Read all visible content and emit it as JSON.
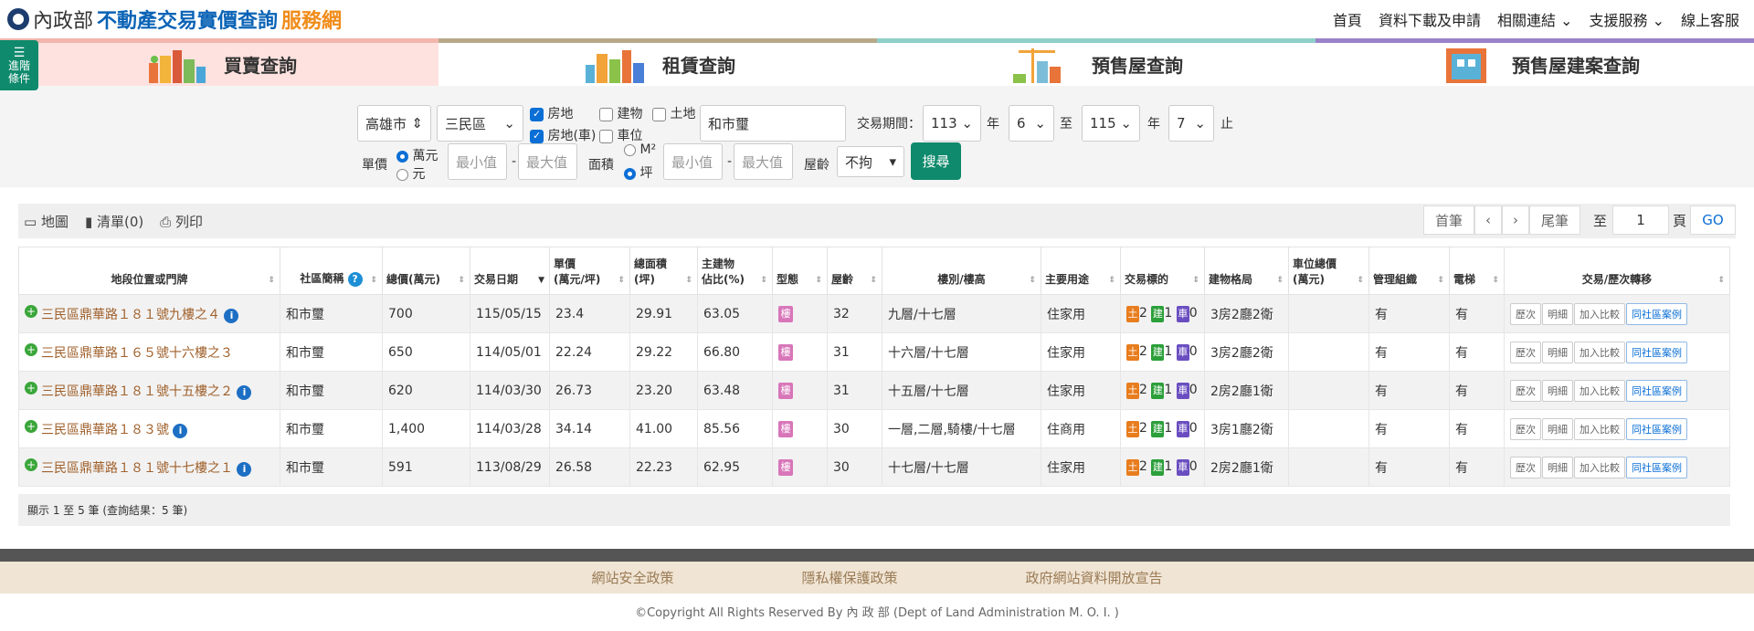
{
  "header": {
    "logo_ministry": "內政部",
    "logo_main": "不動產交易實價查詢",
    "logo_sub": "服務網",
    "nav": [
      "首頁",
      "資料下載及申請",
      "相關連結",
      "支援服務",
      "線上客服"
    ]
  },
  "adv_button": {
    "line1": "進階",
    "line2": "條件"
  },
  "tabs": [
    "買賣查詢",
    "租賃查詢",
    "預售屋查詢",
    "預售屋建案查詢"
  ],
  "filter": {
    "city": "高雄市",
    "district": "三民區",
    "types": {
      "house": "房地",
      "building": "建物",
      "land": "土地",
      "house_car": "房地(車)",
      "parking": "車位"
    },
    "community_value": "和市璽",
    "period_label": "交易期間：",
    "from_year": "113",
    "from_month": "6",
    "to_year": "115",
    "to_month": "7",
    "year_unit": "年",
    "to_label": "至",
    "end_label": "止",
    "unit_price_label": "單價",
    "unit_wan": "萬元",
    "unit_yuan": "元",
    "min_placeholder": "最小值",
    "max_placeholder": "最大值",
    "dash": "-",
    "area_label": "面積",
    "area_m2": "M²",
    "area_ping": "坪",
    "age_label": "屋齡",
    "age_value": "不拘",
    "search_button": "搜尋"
  },
  "toolbar": {
    "map": "地圖",
    "list": "清單(0)",
    "print": "列印",
    "first": "首筆",
    "prev": "‹",
    "next": "›",
    "last": "尾筆",
    "to": "至",
    "page_value": "1",
    "page": "頁",
    "go": "GO"
  },
  "table": {
    "headers": [
      "地段位置或門牌",
      "社區簡稱",
      "總價(萬元)",
      "交易日期",
      "單價\n(萬元/坪)",
      "總面積\n(坪)",
      "主建物\n佔比(%)",
      "型態",
      "屋齡",
      "樓別/樓高",
      "主要用途",
      "交易標的",
      "建物格局",
      "車位總價\n(萬元)",
      "管理組織",
      "電梯",
      "交易/歷次轉移"
    ],
    "rows": [
      {
        "address": "三民區鼎華路１８１號九樓之４",
        "info": true,
        "community": "和市璽",
        "total": "700",
        "date": "115/05/15",
        "unit": "23.4",
        "area": "29.91",
        "ratio": "63.05",
        "type": "樓",
        "age": "32",
        "floor": "九層/十七層",
        "use": "住家用",
        "land": "2",
        "bld": "1",
        "car": "0",
        "layout": "3房2廳2衛",
        "car_price": "",
        "mgmt": "有",
        "elevator": "有"
      },
      {
        "address": "三民區鼎華路１６５號十六樓之３",
        "info": false,
        "community": "和市璽",
        "total": "650",
        "date": "114/05/01",
        "unit": "22.24",
        "area": "29.22",
        "ratio": "66.80",
        "type": "樓",
        "age": "31",
        "floor": "十六層/十七層",
        "use": "住家用",
        "land": "2",
        "bld": "1",
        "car": "0",
        "layout": "3房2廳2衛",
        "car_price": "",
        "mgmt": "有",
        "elevator": "有"
      },
      {
        "address": "三民區鼎華路１８１號十五樓之２",
        "info": true,
        "community": "和市璽",
        "total": "620",
        "date": "114/03/30",
        "unit": "26.73",
        "area": "23.20",
        "ratio": "63.48",
        "type": "樓",
        "age": "31",
        "floor": "十五層/十七層",
        "use": "住家用",
        "land": "2",
        "bld": "1",
        "car": "0",
        "layout": "2房2廳1衛",
        "car_price": "",
        "mgmt": "有",
        "elevator": "有"
      },
      {
        "address": "三民區鼎華路１８３號",
        "info": true,
        "community": "和市璽",
        "total": "1,400",
        "date": "114/03/28",
        "unit": "34.14",
        "area": "41.00",
        "ratio": "85.56",
        "type": "樓",
        "age": "30",
        "floor": "一層,二層,騎樓/十七層",
        "use": "住商用",
        "land": "2",
        "bld": "1",
        "car": "0",
        "layout": "3房1廳2衛",
        "car_price": "",
        "mgmt": "有",
        "elevator": "有"
      },
      {
        "address": "三民區鼎華路１８１號十七樓之１",
        "info": true,
        "community": "和市璽",
        "total": "591",
        "date": "113/08/29",
        "unit": "26.58",
        "area": "22.23",
        "ratio": "62.95",
        "type": "樓",
        "age": "30",
        "floor": "十七層/十七層",
        "use": "住家用",
        "land": "2",
        "bld": "1",
        "car": "0",
        "layout": "2房2廳1衛",
        "car_price": "",
        "mgmt": "有",
        "elevator": "有"
      }
    ],
    "tag_land": "土",
    "tag_bld": "建",
    "tag_car": "車",
    "action_buttons": [
      "歷次",
      "明細",
      "加入比較",
      "同社區案例"
    ]
  },
  "result_text": "顯示 1 至 5 筆 (查詢結果：5 筆)",
  "footer": {
    "links": [
      "網站安全政策",
      "隱私權保護政策",
      "政府網站資料開放宣告"
    ],
    "copyright": "©Copyright All Rights Reserved By 內 政 部 (Dept of Land Administration M. O. I. )"
  },
  "colors": {
    "brand_blue": "#0b63b6",
    "brand_orange": "#f08c1a",
    "accent_green": "#0f8a6c",
    "address_brown": "#a0612c"
  }
}
